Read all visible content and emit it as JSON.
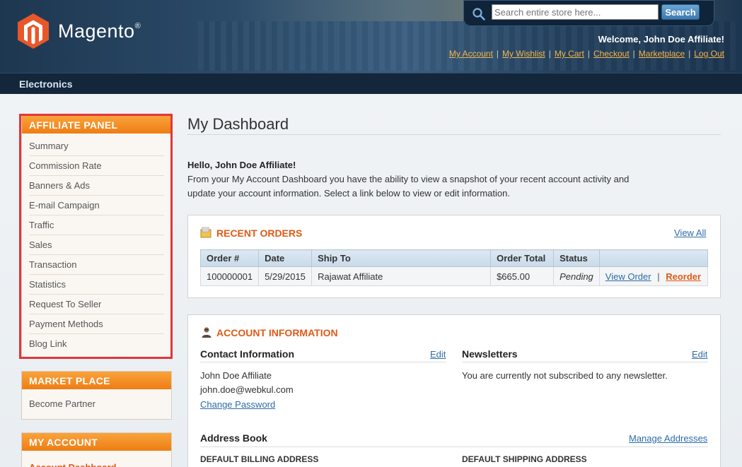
{
  "header": {
    "logo_text": "Magento",
    "logo_reg": "®",
    "search_placeholder": "Search entire store here...",
    "search_button": "Search",
    "welcome": "Welcome, John Doe Affiliate!",
    "links": [
      "My Account",
      "My Wishlist",
      "My Cart",
      "Checkout",
      "Marketplace",
      "Log Out"
    ]
  },
  "nav": {
    "category": "Electronics"
  },
  "sidebar": {
    "affiliate": {
      "title": "AFFILIATE PANEL",
      "items": [
        "Summary",
        "Commission Rate",
        "Banners & Ads",
        "E-mail Campaign",
        "Traffic",
        "Sales",
        "Transaction",
        "Statistics",
        "Request To Seller",
        "Payment Methods",
        "Blog Link"
      ]
    },
    "marketplace": {
      "title": "MARKET PLACE",
      "items": [
        "Become Partner"
      ]
    },
    "account": {
      "title": "MY ACCOUNT",
      "items": [
        "Account Dashboard"
      ]
    }
  },
  "main": {
    "title": "My Dashboard",
    "hello": "Hello, John Doe Affiliate!",
    "intro": "From your My Account Dashboard you have the ability to view a snapshot of your recent account activity and update your account information. Select a link below to view or edit information.",
    "recent_orders": {
      "title": "RECENT ORDERS",
      "view_all": "View All",
      "columns": [
        "Order #",
        "Date",
        "Ship To",
        "Order Total",
        "Status",
        ""
      ],
      "rows": [
        {
          "order": "100000001",
          "date": "5/29/2015",
          "ship_to": "Rajawat Affiliate",
          "total": "$665.00",
          "status": "Pending",
          "view": "View Order",
          "sep": "|",
          "reorder": "Reorder"
        }
      ]
    },
    "account_info": {
      "title": "ACCOUNT INFORMATION",
      "contact_title": "Contact Information",
      "edit": "Edit",
      "name": "John Doe Affiliate",
      "email": "john.doe@webkul.com",
      "change_password": "Change Password",
      "newsletters_title": "Newsletters",
      "newsletters_text": "You are currently not subscribed to any newsletter.",
      "address_book": "Address Book",
      "manage_addresses": "Manage Addresses",
      "default_billing": "DEFAULT BILLING ADDRESS",
      "default_shipping": "DEFAULT SHIPPING ADDRESS"
    }
  }
}
